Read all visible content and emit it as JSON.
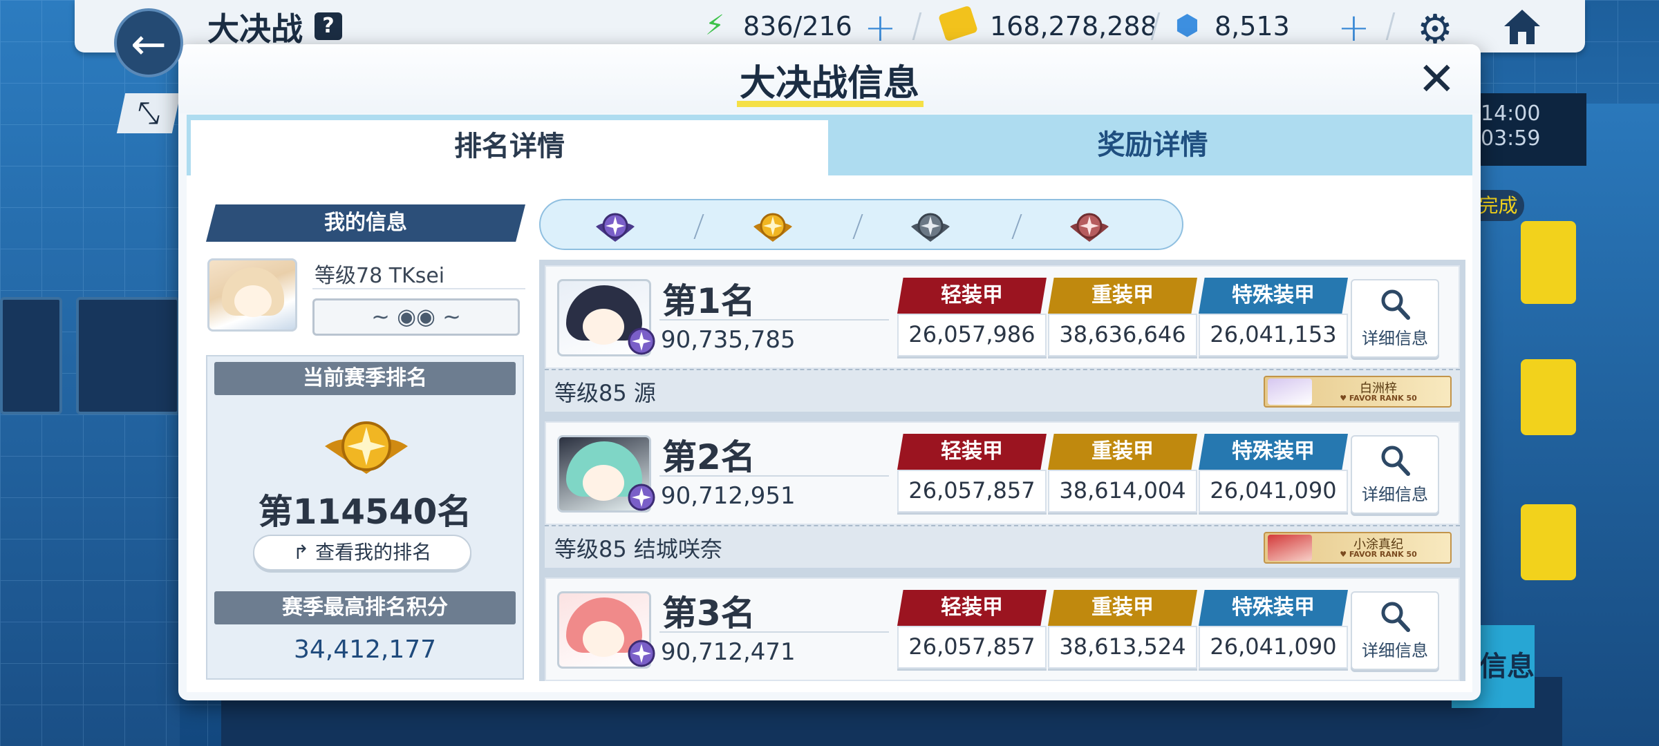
{
  "topbar": {
    "title": "大决战",
    "help": "?",
    "ap": "836/216",
    "credits": "168,278,288",
    "gems": "8,513"
  },
  "hud": {
    "timer_line1": "14:00",
    "timer_line2": "03:59",
    "done_tag": "完成",
    "bottom_info": "信息"
  },
  "modal": {
    "title": "大决战信息",
    "tabs": {
      "rank": "排名详情",
      "reward": "奖励详情"
    },
    "active_tab": "rank"
  },
  "my_info": {
    "header": "我的信息",
    "name": "等级78 TKsei",
    "current_rank_label": "当前赛季排名",
    "current_rank": "第114540名",
    "view_button": "查看我的排名",
    "best_score_label": "赛季最高排名积分",
    "best_score": "34,412,177"
  },
  "filter": {
    "icons": [
      "platinum-rank-icon",
      "gold-rank-icon",
      "silver-rank-icon",
      "bronze-rank-icon"
    ],
    "colors": [
      "#6a4fb3",
      "#e0a21c",
      "#5e6b78",
      "#b0585a"
    ]
  },
  "armor_labels": {
    "light": "轻装甲",
    "heavy": "重装甲",
    "special": "特殊装甲"
  },
  "detail_label": "详细信息",
  "entries": [
    {
      "rank": "第1名",
      "score": "90,735,785",
      "light": "26,057,986",
      "heavy": "38,636,646",
      "special": "26,041,153",
      "level_name": "等级85 源",
      "favor_name": "白洲梓",
      "favor_rank": "♥ FAVOR RANK 50",
      "hair": "#2a2f45",
      "favor_hair": "#d6c7f0"
    },
    {
      "rank": "第2名",
      "score": "90,712,951",
      "light": "26,057,857",
      "heavy": "38,614,004",
      "special": "26,041,090",
      "level_name": "等级85 结城咲奈",
      "favor_name": "小涂真纪",
      "favor_rank": "♥ FAVOR RANK 50",
      "hair": "#7fd6c6",
      "favor_hair": "#d33a3a"
    },
    {
      "rank": "第3名",
      "score": "90,712,471",
      "light": "26,057,857",
      "heavy": "38,613,524",
      "special": "26,041,090",
      "level_name": "",
      "favor_name": "",
      "favor_rank": "",
      "hair": "#f08a8a",
      "favor_hair": "#f08a8a"
    }
  ]
}
